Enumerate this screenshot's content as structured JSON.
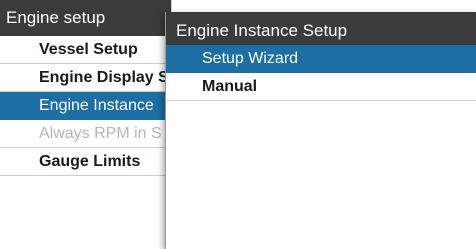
{
  "left_menu": {
    "title": "Engine setup",
    "items": [
      {
        "label": "Vessel Setup",
        "state": "normal"
      },
      {
        "label": "Engine Display Se",
        "state": "normal"
      },
      {
        "label": "Engine Instance",
        "state": "selected"
      },
      {
        "label": "Always RPM in S",
        "state": "disabled"
      },
      {
        "label": "Gauge Limits",
        "state": "normal"
      }
    ]
  },
  "submenu": {
    "title": "Engine Instance Setup",
    "items": [
      {
        "label": "Setup Wizard",
        "state": "selected"
      },
      {
        "label": "Manual",
        "state": "normal"
      }
    ]
  },
  "colors": {
    "titlebar": "#3b3b3b",
    "selected": "#1c6ea4",
    "divider": "#e6c0c6",
    "disabled_text": "#b5b5b5"
  }
}
